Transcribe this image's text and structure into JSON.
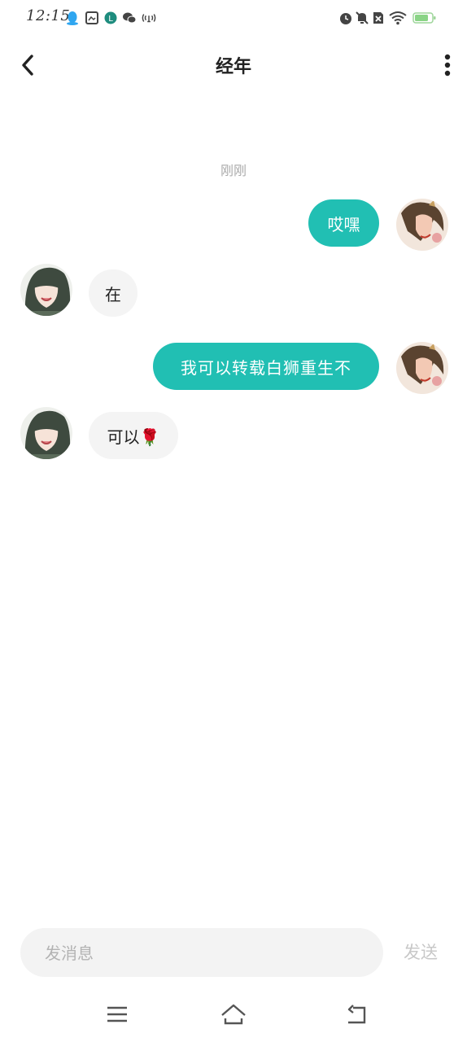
{
  "status_bar": {
    "time": "12:15",
    "left_icons": [
      "qq-icon",
      "gallery-icon",
      "app-icon",
      "wechat-icon",
      "hotspot-icon"
    ],
    "right_icons": [
      "alarm-icon",
      "mute-icon",
      "no-sim-icon",
      "wifi-icon",
      "battery-icon"
    ]
  },
  "header": {
    "title": "经年"
  },
  "chat": {
    "timestamp": "刚刚",
    "messages": [
      {
        "from": "me",
        "text": "哎嘿"
      },
      {
        "from": "other",
        "text": "在"
      },
      {
        "from": "me",
        "text": "我可以转载白狮重生不"
      },
      {
        "from": "other",
        "text": "可以🌹"
      }
    ]
  },
  "composer": {
    "placeholder": "发消息",
    "value": "",
    "send_label": "发送"
  },
  "colors": {
    "accent": "#21bfb3",
    "incoming_bubble": "#f4f4f4",
    "background": "#ffffff"
  },
  "nav": [
    "menu-icon",
    "home-icon",
    "back-icon"
  ]
}
